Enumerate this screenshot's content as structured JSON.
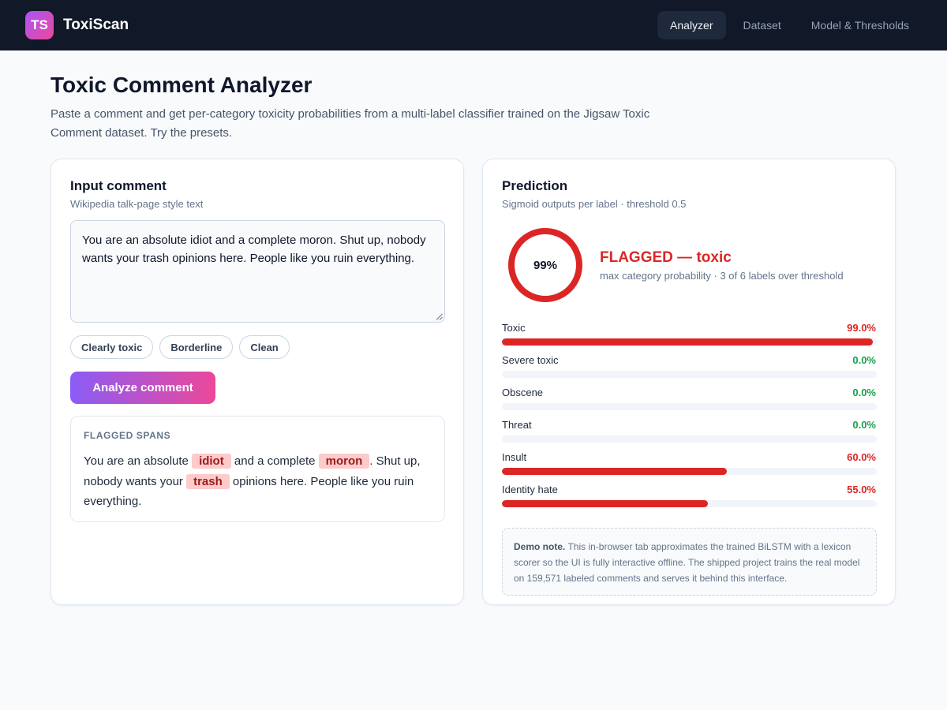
{
  "app": {
    "logo_text": "TS",
    "name": "ToxiScan"
  },
  "nav": {
    "tabs": [
      "Analyzer",
      "Dataset",
      "Model & Thresholds"
    ],
    "active": "Analyzer"
  },
  "header": {
    "title": "Toxic Comment Analyzer",
    "description": "Paste a comment and get per-category toxicity probabilities from a multi-label classifier trained on the Jigsaw Toxic Comment dataset. Try the presets."
  },
  "input_card": {
    "title": "Input comment",
    "subtitle": "Wikipedia talk-page style text",
    "comment_value": "You are an absolute idiot and a complete moron. Shut up, nobody wants your trash opinions here. People like you ruin everything.",
    "presets": [
      "Clearly toxic",
      "Borderline",
      "Clean"
    ],
    "analyze_label": "Analyze comment",
    "spans_heading": "FLAGGED SPANS",
    "spans_segments": [
      {
        "text": "You are an absolute ",
        "flagged": false
      },
      {
        "text": "idiot",
        "flagged": true
      },
      {
        "text": " and a complete ",
        "flagged": false
      },
      {
        "text": "moron",
        "flagged": true
      },
      {
        "text": ". Shut up, nobody wants your ",
        "flagged": false
      },
      {
        "text": "trash",
        "flagged": true
      },
      {
        "text": " opinions here. People like you ruin everything.",
        "flagged": false
      }
    ]
  },
  "prediction_card": {
    "title": "Prediction",
    "subtitle": "Sigmoid outputs per label · threshold 0.5",
    "gauge_value": 0.99,
    "gauge_text": "99%",
    "verdict_title": "FLAGGED — toxic",
    "verdict_sub": "max category probability · 3 of 6 labels over threshold",
    "labels": [
      {
        "name": "Toxic",
        "value": 0.99,
        "display": "99.0%"
      },
      {
        "name": "Severe toxic",
        "value": 0.0,
        "display": "0.0%"
      },
      {
        "name": "Obscene",
        "value": 0.0,
        "display": "0.0%"
      },
      {
        "name": "Threat",
        "value": 0.0,
        "display": "0.0%"
      },
      {
        "name": "Insult",
        "value": 0.6,
        "display": "60.0%"
      },
      {
        "name": "Identity hate",
        "value": 0.55,
        "display": "55.0%"
      }
    ],
    "note_bold": "Demo note.",
    "note_text": " This in-browser tab approximates the trained BiLSTM with a lexicon scorer so the UI is fully interactive offline. The shipped project trains the real model on 159,571 labeled comments and serves it behind this interface."
  },
  "colors": {
    "flagged": "#dc2626",
    "clean": "#16a34a",
    "accent_start": "#8b5cf6",
    "accent_end": "#ec4899"
  }
}
